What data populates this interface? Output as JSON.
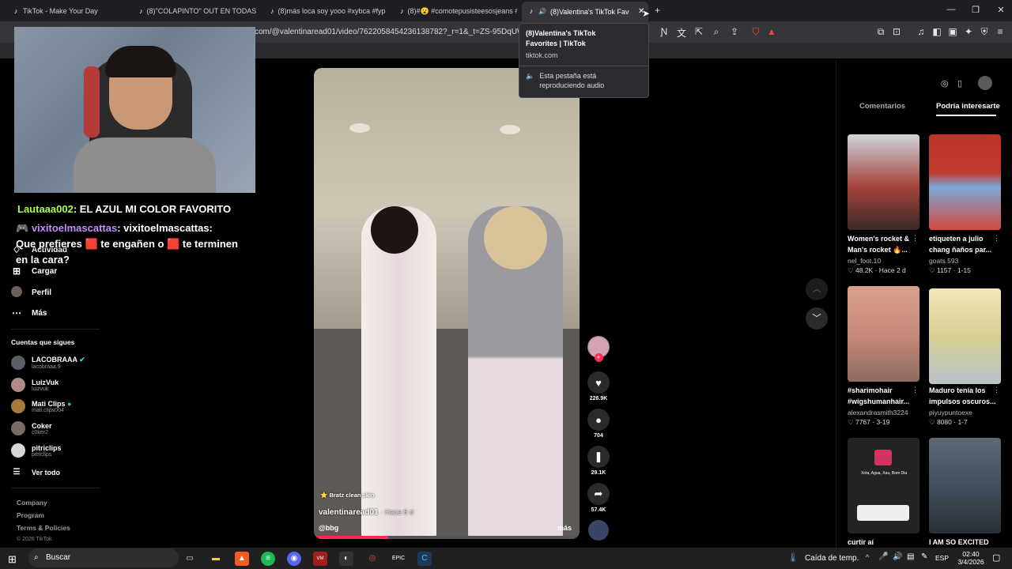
{
  "tabs": [
    {
      "label": "TikTok - Make Your Day"
    },
    {
      "label": "(8)\"COLAPINTO\" OUT EN TODAS LAS"
    },
    {
      "label": "(8)más loca soy yooo #xybca #fyp | s"
    },
    {
      "label": "(8)#😮 #comotepusisteesosjeans #v"
    },
    {
      "label": "(8)Valentina's TikTok Favorites"
    }
  ],
  "address_bar": {
    "url": "com/@valentinaread01/video/7622058454236138782?_r=1&_t=ZS-95DqUWTNm"
  },
  "tooltip": {
    "title": "(8)Valentina's TikTok Favorites | TikTok",
    "domain": "tiktok.com",
    "audio_text": "Esta pestaña está reproduciendo audio"
  },
  "chat": {
    "line1_user": "Lautaaa002",
    "line1_text": ": EL AZUL MI COLOR FAVORITO",
    "line2_user": "vixitoelmascattas",
    "line2_text": ": vixitoelmascattas:",
    "line3": "Que prefieres",
    "line3b": "te engañen o",
    "line3c": "te terminen",
    "line4": "en la cara?"
  },
  "sidebar": {
    "nav": [
      {
        "label": "Actividad",
        "icon": "bell-icon"
      },
      {
        "label": "Cargar",
        "icon": "plus-square-icon"
      },
      {
        "label": "Perfil",
        "icon": "avatar"
      },
      {
        "label": "Más",
        "icon": "more-icon"
      }
    ],
    "following_title": "Cuentas que sigues",
    "following": [
      {
        "name": "LACOBRAAA",
        "handle": "lacobraaa.9",
        "verified": true,
        "live": false,
        "color": "#5a5f66"
      },
      {
        "name": "LuizVuk",
        "handle": "luizvuk",
        "verified": false,
        "live": false,
        "color": "#b08a88"
      },
      {
        "name": "Mati Clips",
        "handle": "mati.clips004",
        "verified": false,
        "live": true,
        "color": "#a57a3c"
      },
      {
        "name": "Coker",
        "handle": "c0ker2",
        "verified": false,
        "live": false,
        "color": "#7b6b62"
      },
      {
        "name": "pitriclips",
        "handle": "pitriclips",
        "verified": false,
        "live": false,
        "color": "#d8d8d8"
      }
    ],
    "see_all": "Ver todo",
    "footer": [
      "Company",
      "Program",
      "Terms & Policies",
      "© 2026 TikTok"
    ]
  },
  "video": {
    "sticker": "Bratz clean skin",
    "username": "valentinaread01",
    "time": "· Hace 6 d",
    "music": "@bbg",
    "more": "más",
    "progress_pct": 28
  },
  "actions": [
    {
      "icon": "heart-icon",
      "count": "226.9K"
    },
    {
      "icon": "comment-icon",
      "count": "704"
    },
    {
      "icon": "bookmark-icon",
      "count": "29.1K"
    },
    {
      "icon": "share-icon",
      "count": "57.4K"
    }
  ],
  "right_panel": {
    "tab_comments": "Comentarios",
    "tab_interest": "Podría interesarte",
    "items": [
      {
        "title1": "Women's rocket &",
        "title2": "Man's rocket 🔥...",
        "author": "nel_foot.10",
        "stats": "♡ 48.2K · Hace 2 d",
        "bg": "#a5423b"
      },
      {
        "title1": "etiqueten a julio",
        "title2": "chang ñaños par...",
        "author": "goats.593",
        "stats": "♡ 1157 · 1-15",
        "bg": "#c23a2e"
      },
      {
        "title1": "#sharimohair",
        "title2": "#wigshumanhair...",
        "author": "alexandrasmith3224",
        "stats": "♡ 7767 · 3-19",
        "bg": "#c88a7c"
      },
      {
        "title1": "Maduro tenía los",
        "title2": "impulsos oscuros...",
        "author": "piyuypuntoexe",
        "stats": "♡ 8080 · 1-7",
        "bg": "#d8cf95"
      },
      {
        "title1": "curtir aí",
        "title2": "",
        "author": "",
        "stats": "",
        "bg": "#2a2a2a",
        "caption": "Xota, Agua, Xau, Bom Dia"
      },
      {
        "title1": "I AM SO EXCITED",
        "title2": "",
        "author": "",
        "stats": "",
        "bg": "#4b5a66"
      }
    ]
  },
  "taskbar": {
    "search": "Buscar",
    "weather": "Caída de temp.",
    "lang": "ESP",
    "time": "02:40",
    "date": "3/4/2026"
  }
}
